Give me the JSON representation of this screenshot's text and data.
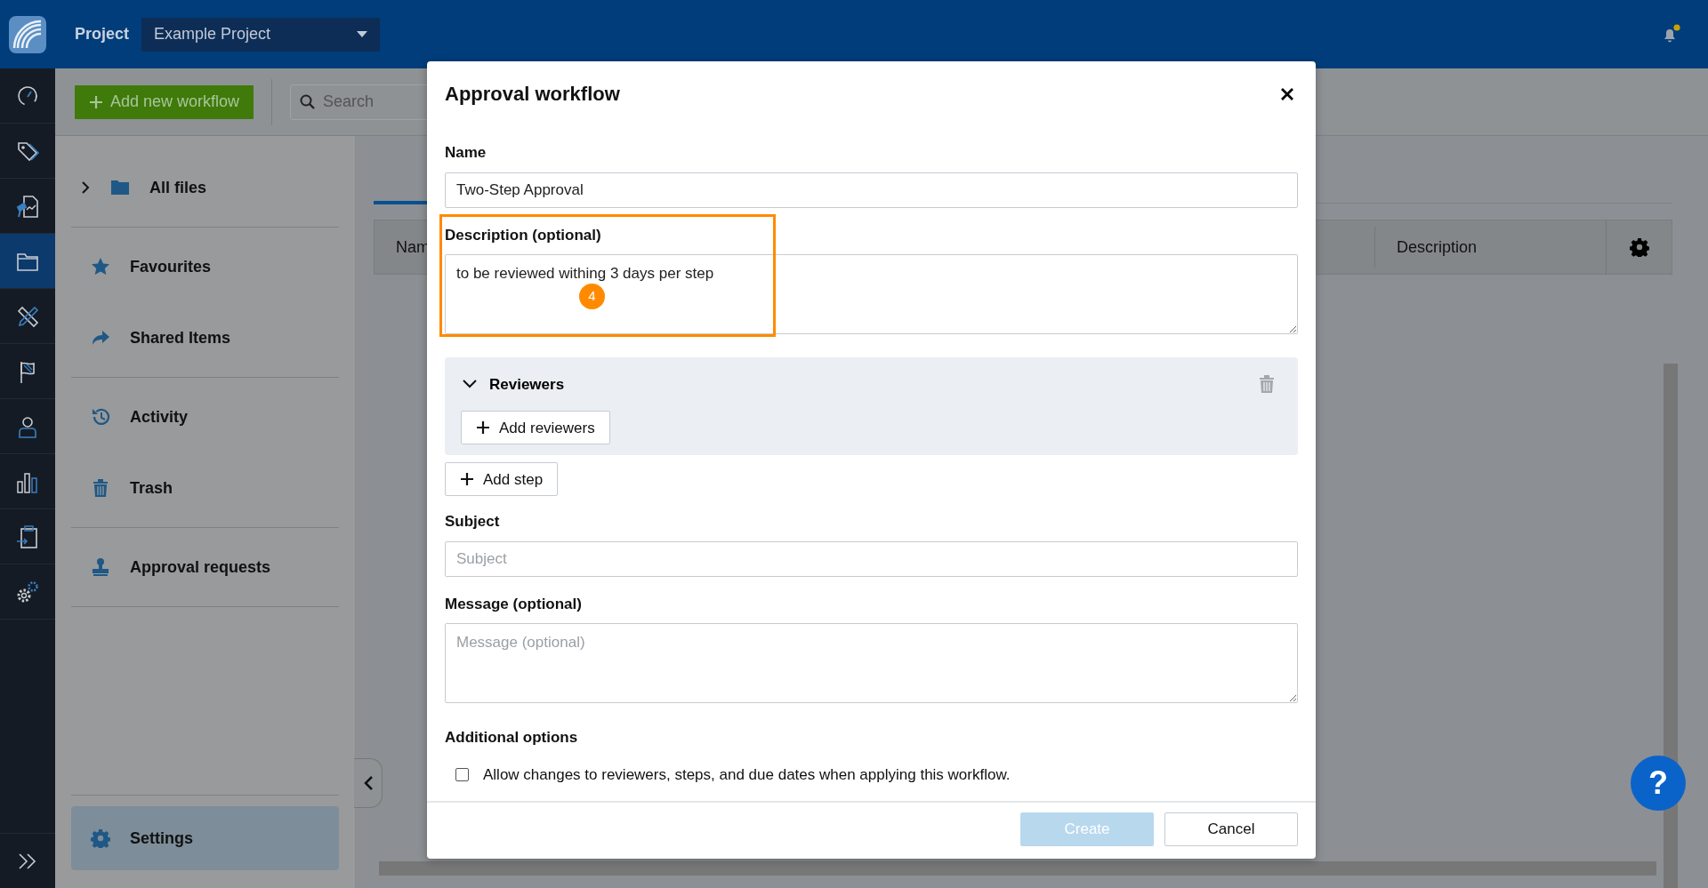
{
  "topbar": {
    "project_label": "Project",
    "project": "Example Project",
    "notification": true
  },
  "rail": {
    "items": [
      {
        "selected": false
      },
      {
        "selected": false
      },
      {
        "selected": false
      },
      {
        "selected": true
      },
      {
        "selected": false
      },
      {
        "selected": false
      },
      {
        "selected": false
      },
      {
        "selected": false
      },
      {
        "selected": false
      },
      {
        "selected": false
      }
    ]
  },
  "toolbar": {
    "add_button": "Add new workflow",
    "search_placeholder": "Search"
  },
  "sidebar": {
    "groups": [
      [
        {
          "label": "All files",
          "expanded": false
        }
      ],
      [
        {
          "label": "Favourites"
        },
        {
          "label": "Shared Items"
        }
      ],
      [
        {
          "label": "Activity"
        },
        {
          "label": "Trash"
        }
      ],
      [
        {
          "label": "Approval requests"
        }
      ]
    ],
    "settings": {
      "label": "Settings",
      "selected": true
    }
  },
  "table": {
    "columns": [
      "Nam",
      "Description"
    ]
  },
  "dialog": {
    "title": "Approval workflow",
    "body": [
      {
        "kind": "input",
        "label": "Name",
        "value": "Two-Step Approval"
      },
      {
        "kind": "textarea",
        "label": "Description (optional)",
        "value": "to be reviewed withing 3 days per step",
        "annotation": "4"
      },
      {
        "kind": "step",
        "title": "Reviewers",
        "expanded": true,
        "button": "Add reviewers"
      },
      {
        "kind": "button",
        "label": "Add step"
      },
      {
        "kind": "input",
        "label": "Subject",
        "placeholder": "Subject"
      },
      {
        "kind": "textarea",
        "label": "Message (optional)",
        "placeholder": "Message (optional)"
      },
      {
        "kind": "heading",
        "label": "Additional options"
      },
      {
        "kind": "checkbox",
        "label": "Allow changes to reviewers, steps, and due dates when applying this workflow.",
        "checked": false
      }
    ],
    "footer": [
      {
        "label": "Create",
        "kind": "primary",
        "disabled": true
      },
      {
        "label": "Cancel",
        "kind": "secondary",
        "disabled": false
      }
    ]
  },
  "help": {
    "label": "?"
  }
}
